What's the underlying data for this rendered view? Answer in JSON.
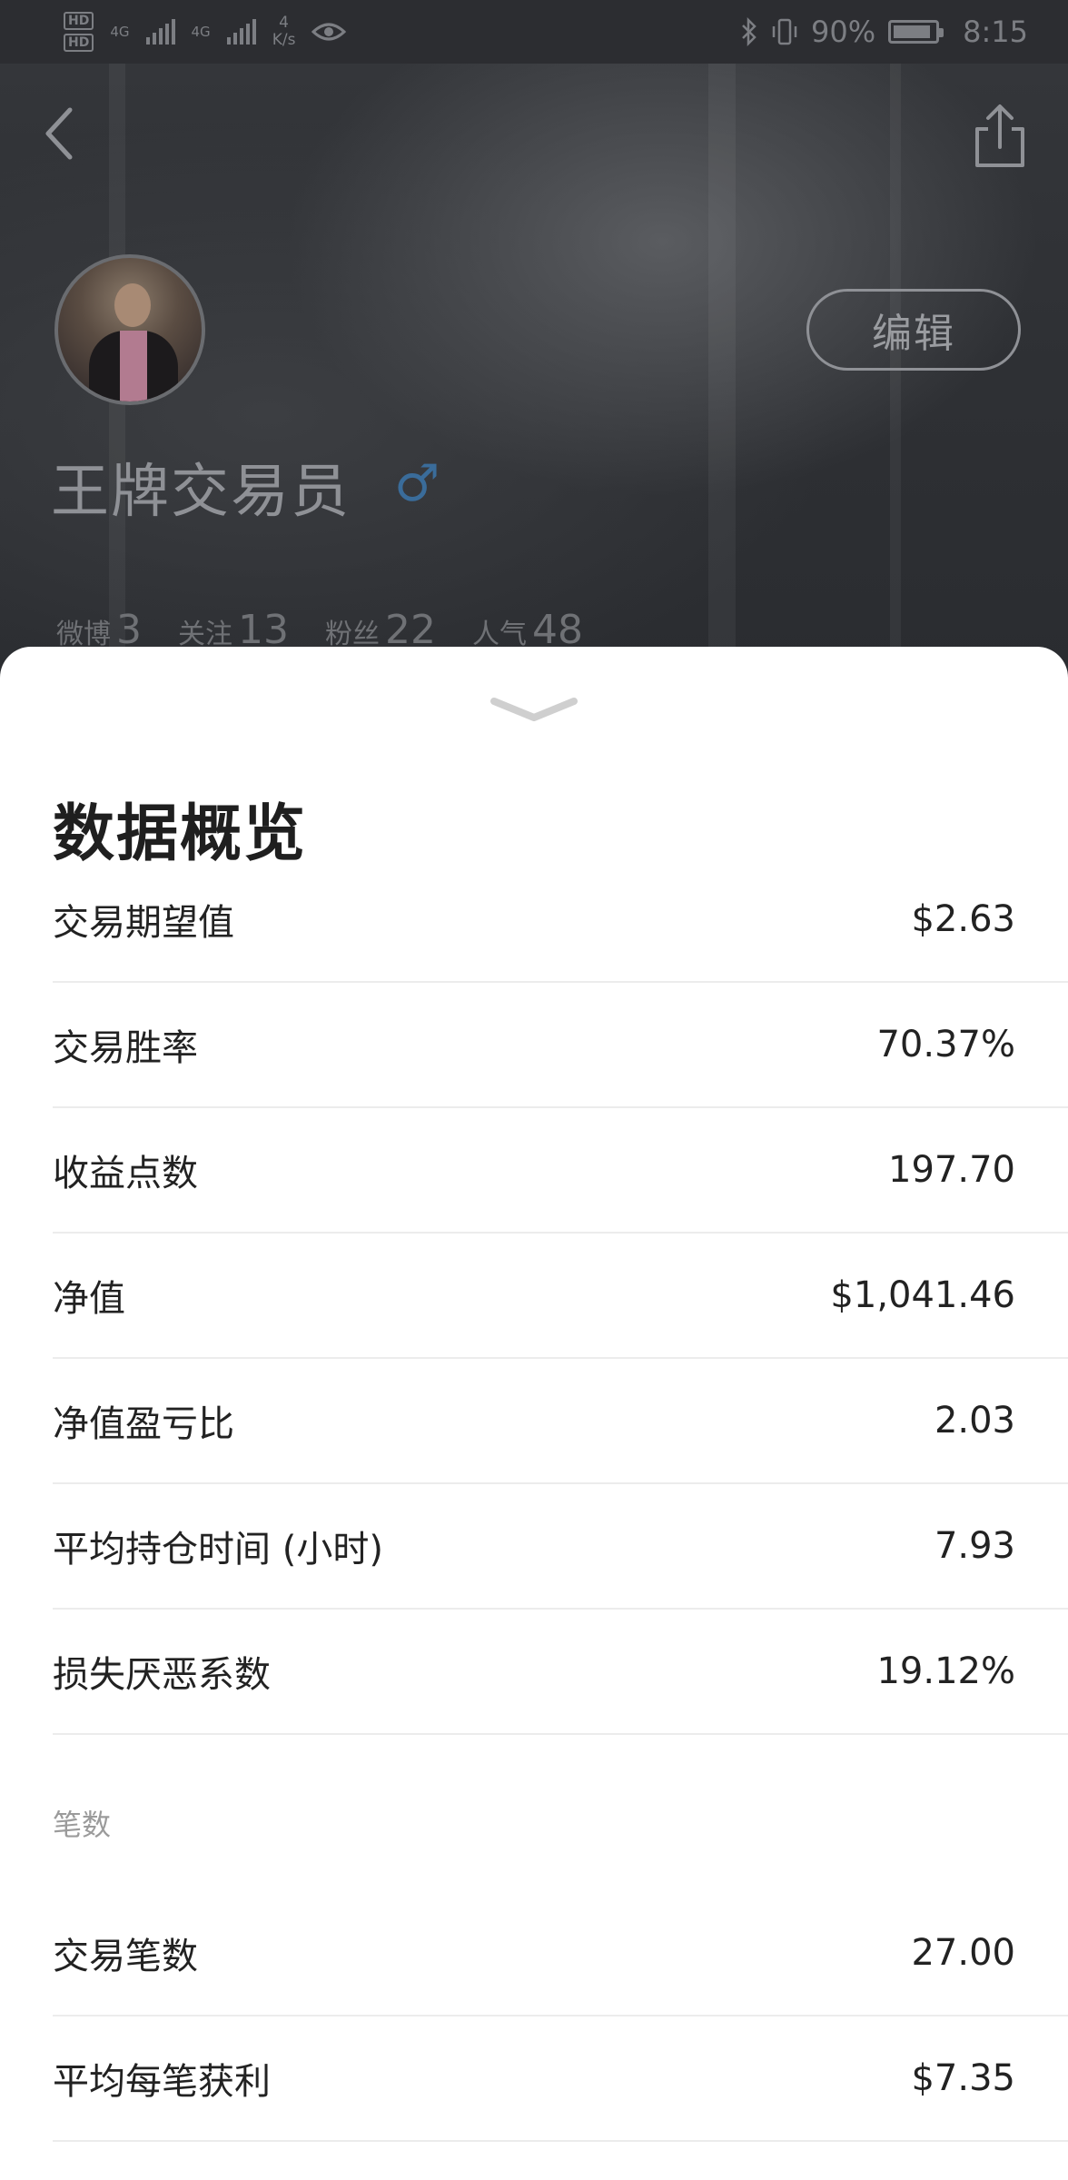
{
  "status_bar": {
    "hd1": "HD",
    "hd2": "HD",
    "net1": "4G",
    "net2": "4G",
    "speed_value": "4",
    "speed_unit": "K/s",
    "battery_percent": "90%",
    "time": "8:15"
  },
  "profile": {
    "username": "王牌交易员",
    "gender_symbol": "♂",
    "edit_label": "编辑",
    "stats": [
      {
        "label": "微博",
        "value": "3"
      },
      {
        "label": "关注",
        "value": "13"
      },
      {
        "label": "粉丝",
        "value": "22"
      },
      {
        "label": "人气",
        "value": "48"
      }
    ]
  },
  "sheet": {
    "title": "数据概览",
    "rows": [
      {
        "label": "交易期望值",
        "value": "$2.63"
      },
      {
        "label": "交易胜率",
        "value": "70.37%"
      },
      {
        "label": "收益点数",
        "value": "197.70"
      },
      {
        "label": "净值",
        "value": "$1,041.46"
      },
      {
        "label": "净值盈亏比",
        "value": "2.03"
      },
      {
        "label": "平均持仓时间 (小时)",
        "value": "7.93"
      },
      {
        "label": "损失厌恶系数",
        "value": "19.12%"
      }
    ],
    "section_label": "笔数",
    "count_rows": [
      {
        "label": "交易笔数",
        "value": "27.00"
      },
      {
        "label": "平均每笔获利",
        "value": "$7.35"
      }
    ]
  },
  "colors": {
    "overlay_bg": "#2b2d31",
    "sheet_bg": "#ffffff",
    "text_primary": "#222222",
    "section_label": "#9b9b9b",
    "gender_icon": "#3a6c9a"
  },
  "icons": [
    "back-chevron-icon",
    "share-icon",
    "eye-icon",
    "bluetooth-icon",
    "vibrate-icon",
    "battery-icon",
    "collapse-chevron-icon"
  ]
}
